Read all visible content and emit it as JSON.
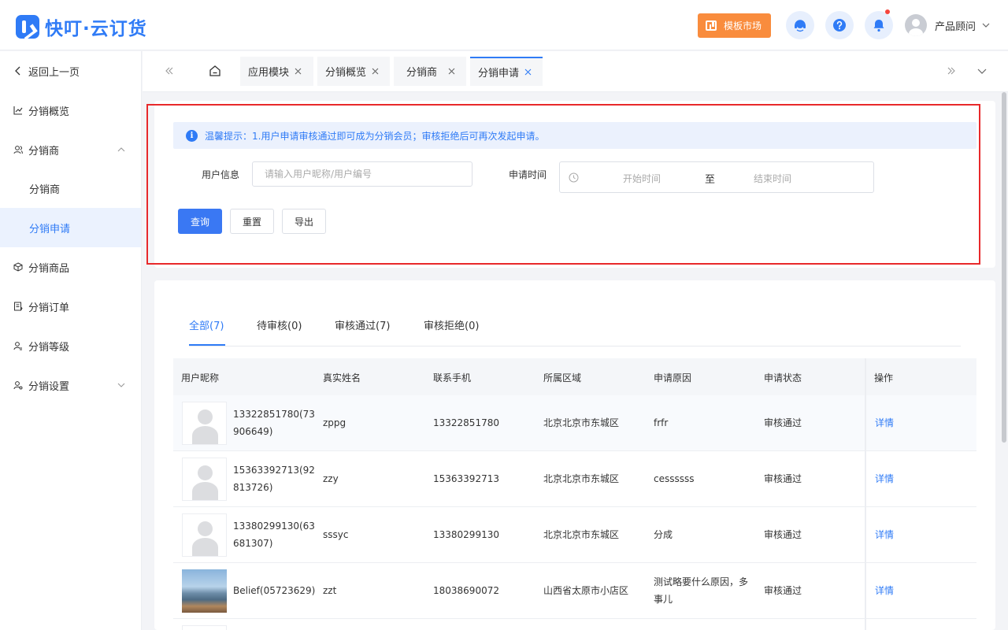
{
  "app": {
    "logo_text": "快叮·云订货",
    "brand_color": "#2f7bf6"
  },
  "header": {
    "market_label": "模板市场",
    "icons": [
      "customer-service-icon",
      "help-icon",
      "bell-icon"
    ],
    "user_name": "产品顾问"
  },
  "sidebar": {
    "back_label": "返回上一页",
    "items": [
      {
        "label": "分销概览",
        "icon": "chart-line-icon"
      },
      {
        "label": "分销商",
        "icon": "users-icon",
        "expanded": true
      },
      {
        "label": "分销商",
        "sub": true
      },
      {
        "label": "分销申请",
        "sub": true,
        "active": true
      },
      {
        "label": "分销商品",
        "icon": "box-icon"
      },
      {
        "label": "分销订单",
        "icon": "order-icon"
      },
      {
        "label": "分销等级",
        "icon": "user-level-icon"
      },
      {
        "label": "分销设置",
        "icon": "user-settings-icon",
        "expanded": false
      }
    ]
  },
  "tabs": [
    {
      "label": "应用模块"
    },
    {
      "label": "分销概览"
    },
    {
      "label": "分销商"
    },
    {
      "label": "分销申请",
      "active": true
    }
  ],
  "filter": {
    "tip": "温馨提示：1.用户申请审核通过即可成为分销会员；审核拒绝后可再次发起申请。",
    "user_info_label": "用户信息",
    "user_info_placeholder": "请输入用户昵称/用户编号",
    "apply_time_label": "申请时间",
    "start_placeholder": "开始时间",
    "range_sep": "至",
    "end_placeholder": "结束时间",
    "query_label": "查询",
    "reset_label": "重置",
    "export_label": "导出"
  },
  "status_tabs": [
    {
      "label": "全部(7)",
      "active": true
    },
    {
      "label": "待审核(0)"
    },
    {
      "label": "审核通过(7)"
    },
    {
      "label": "审核拒绝(0)"
    }
  ],
  "table": {
    "columns": [
      "用户昵称",
      "真实姓名",
      "联系手机",
      "所属区域",
      "申请原因",
      "申请状态",
      "操作"
    ],
    "rows": [
      {
        "nick_1": "13322851780(73",
        "nick_2": "906649)",
        "real_name": "zppg",
        "phone": "13322851780",
        "region": "北京北京市东城区",
        "reason_1": "frfr",
        "reason_2": "",
        "status": "审核通过",
        "action": "详情",
        "avatar": "default"
      },
      {
        "nick_1": "15363392713(92",
        "nick_2": "813726)",
        "real_name": "zzy",
        "phone": "15363392713",
        "region": "北京北京市东城区",
        "reason_1": "cessssss",
        "reason_2": "",
        "status": "审核通过",
        "action": "详情",
        "avatar": "default"
      },
      {
        "nick_1": "13380299130(63",
        "nick_2": "681307)",
        "real_name": "sssyc",
        "phone": "13380299130",
        "region": "北京北京市东城区",
        "reason_1": "分成",
        "reason_2": "",
        "status": "审核通过",
        "action": "详情",
        "avatar": "default"
      },
      {
        "nick_1": "Belief(05723629)",
        "nick_2": "",
        "real_name": "zzt",
        "phone": "18038690072",
        "region": "山西省太原市小店区",
        "reason_1": "测试略要什么原因，多",
        "reason_2": "事儿",
        "status": "审核通过",
        "action": "详情",
        "avatar": "photo"
      }
    ]
  }
}
